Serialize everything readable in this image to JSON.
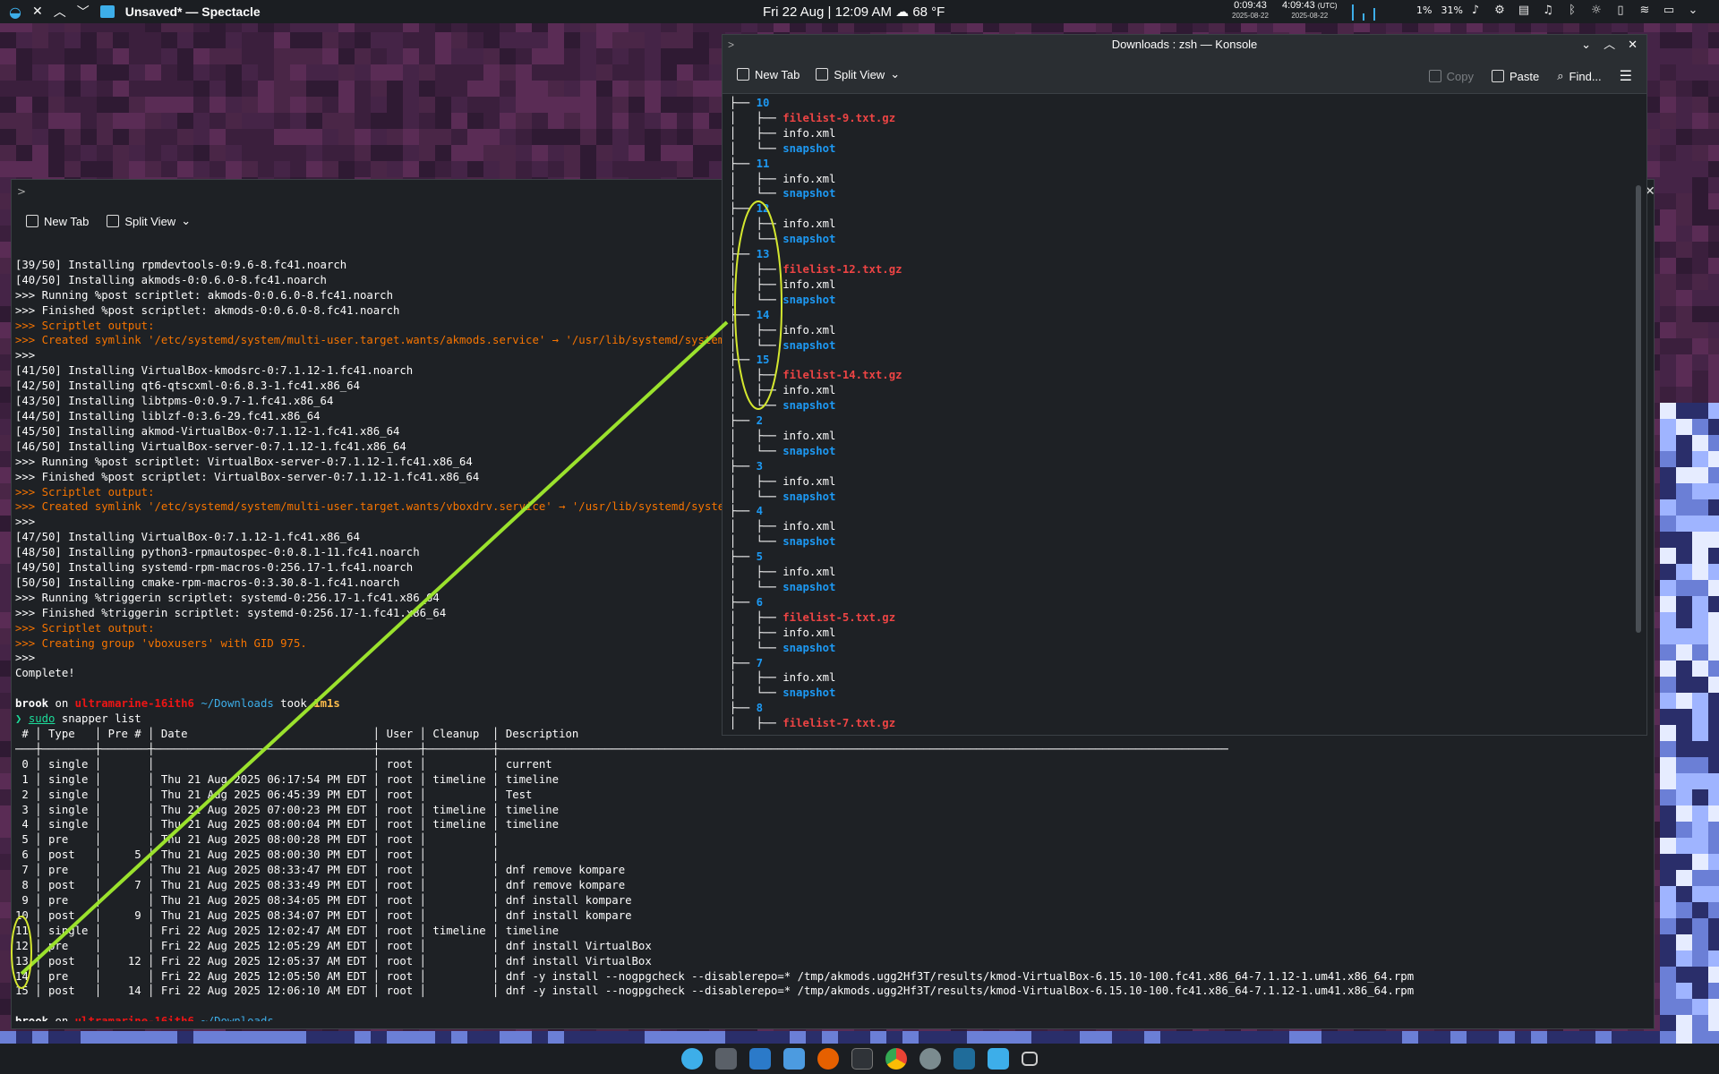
{
  "top_panel": {
    "app_title": "Unsaved* — Spectacle",
    "clock": "Fri 22 Aug | 12:09 AM",
    "weather": "68 °F",
    "tz_local_time": "0:09:43",
    "tz_local_date": "2025-08-22",
    "tz_utc_time": "4:09:43",
    "tz_utc_label": "(UTC)",
    "tz_utc_date": "2025-08-22",
    "cpu": "1%",
    "mem": "31%"
  },
  "back_window": {
    "toolbar": {
      "new_tab": "New Tab",
      "split_view": "Split View"
    },
    "install_lines": [
      "[39/50] Installing rpmdevtools-0:9.6-8.fc41.noarch",
      "[40/50] Installing akmods-0:0.6.0-8.fc41.noarch",
      ">>> Running %post scriptlet: akmods-0:0.6.0-8.fc41.noarch",
      ">>> Finished %post scriptlet: akmods-0:0.6.0-8.fc41.noarch"
    ],
    "scriptlet_1": ">>> Scriptlet output:",
    "symlink_1": ">>> Created symlink '/etc/systemd/system/multi-user.target.wants/akmods.service' → '/usr/lib/systemd/system/akmods.service'.",
    "sep_1": ">>>",
    "install_lines_2": [
      "[41/50] Installing VirtualBox-kmodsrc-0:7.1.12-1.fc41.noarch",
      "[42/50] Installing qt6-qtscxml-0:6.8.3-1.fc41.x86_64",
      "[43/50] Installing libtpms-0:0.9.7-1.fc41.x86_64",
      "[44/50] Installing liblzf-0:3.6-29.fc41.x86_64",
      "[45/50] Installing akmod-VirtualBox-0:7.1.12-1.fc41.x86_64",
      "[46/50] Installing VirtualBox-server-0:7.1.12-1.fc41.x86_64",
      ">>> Running %post scriptlet: VirtualBox-server-0:7.1.12-1.fc41.x86_64",
      ">>> Finished %post scriptlet: VirtualBox-server-0:7.1.12-1.fc41.x86_64"
    ],
    "scriptlet_2": ">>> Scriptlet output:",
    "symlink_2": ">>> Created symlink '/etc/systemd/system/multi-user.target.wants/vboxdrv.service' → '/usr/lib/systemd/system/vboxdrv.service'.",
    "sep_2": ">>>",
    "install_lines_3": [
      "[47/50] Installing VirtualBox-0:7.1.12-1.fc41.x86_64",
      "[48/50] Installing python3-rpmautospec-0:0.8.1-11.fc41.noarch",
      "[49/50] Installing systemd-rpm-macros-0:256.17-1.fc41.noarch",
      "[50/50] Installing cmake-rpm-macros-0:3.30.8-1.fc41.noarch",
      ">>> Running %triggerin scriptlet: systemd-0:256.17-1.fc41.x86_64",
      ">>> Finished %triggerin scriptlet: systemd-0:256.17-1.fc41.x86_64"
    ],
    "scriptlet_3": ">>> Scriptlet output:",
    "group_line": ">>> Creating group 'vboxusers' with GID 975.",
    "sep_3": ">>>",
    "complete": "Complete!",
    "prompt_user": "brook",
    "prompt_on": "on",
    "prompt_host": "ultramarine-16ith6",
    "prompt_dir": "~/Downloads",
    "prompt_took": "took",
    "prompt_time": "1m1s",
    "prompt_char": "❯",
    "cmd_sudo": "sudo",
    "cmd_rest": "snapper list",
    "table_header": " # │ Type   │ Pre # │ Date                            │ User │ Cleanup  │ Description",
    "table_sep": "───┼────────┼───────┼─────────────────────────────────┼──────┼──────────┼──────────────────────────────────────────────────────────────────────────────────────────────────────────────",
    "table_rows": [
      " 0 │ single │       │                                 │ root │          │ current",
      " 1 │ single │       │ Thu 21 Aug 2025 06:17:54 PM EDT │ root │ timeline │ timeline",
      " 2 │ single │       │ Thu 21 Aug 2025 06:45:39 PM EDT │ root │          │ Test",
      " 3 │ single │       │ Thu 21 Aug 2025 07:00:23 PM EDT │ root │ timeline │ timeline",
      " 4 │ single │       │ Thu 21 Aug 2025 08:00:04 PM EDT │ root │ timeline │ timeline",
      " 5 │ pre    │       │ Thu 21 Aug 2025 08:00:28 PM EDT │ root │          │",
      " 6 │ post   │     5 │ Thu 21 Aug 2025 08:00:30 PM EDT │ root │          │",
      " 7 │ pre    │       │ Thu 21 Aug 2025 08:33:47 PM EDT │ root │          │ dnf remove kompare",
      " 8 │ post   │     7 │ Thu 21 Aug 2025 08:33:49 PM EDT │ root │          │ dnf remove kompare",
      " 9 │ pre    │       │ Thu 21 Aug 2025 08:34:05 PM EDT │ root │          │ dnf install kompare",
      "10 │ post   │     9 │ Thu 21 Aug 2025 08:34:07 PM EDT │ root │          │ dnf install kompare",
      "11 │ single │       │ Fri 22 Aug 2025 12:02:47 AM EDT │ root │ timeline │ timeline",
      "12 │ pre    │       │ Fri 22 Aug 2025 12:05:29 AM EDT │ root │          │ dnf install VirtualBox",
      "13 │ post   │    12 │ Fri 22 Aug 2025 12:05:37 AM EDT │ root │          │ dnf install VirtualBox",
      "14 │ pre    │       │ Fri 22 Aug 2025 12:05:50 AM EDT │ root │          │ dnf -y install --nogpgcheck --disablerepo=* /tmp/akmods.ugg2Hf3T/results/kmod-VirtualBox-6.15.10-100.fc41.x86_64-7.1.12-1.um41.x86_64.rpm",
      "15 │ post   │    14 │ Fri 22 Aug 2025 12:06:10 AM EDT │ root │          │ dnf -y install --nogpgcheck --disablerepo=* /tmp/akmods.ugg2Hf3T/results/kmod-VirtualBox-6.15.10-100.fc41.x86_64-7.1.12-1.um41.x86_64.rpm"
    ]
  },
  "front_window": {
    "title": "Downloads : zsh — Konsole",
    "toolbar": {
      "new_tab": "New Tab",
      "split_view": "Split View",
      "copy": "Copy",
      "paste": "Paste",
      "find": "Find..."
    },
    "tree": [
      {
        "indent": "├── ",
        "text": "10",
        "kind": "dir"
      },
      {
        "indent": "│   ├── ",
        "text": "filelist-9.txt.gz",
        "kind": "gz"
      },
      {
        "indent": "│   ├── ",
        "text": "info.xml",
        "kind": "file"
      },
      {
        "indent": "│   └── ",
        "text": "snapshot",
        "kind": "snap"
      },
      {
        "indent": "├── ",
        "text": "11",
        "kind": "dir"
      },
      {
        "indent": "│   ├── ",
        "text": "info.xml",
        "kind": "file"
      },
      {
        "indent": "│   └── ",
        "text": "snapshot",
        "kind": "snap"
      },
      {
        "indent": "├── ",
        "text": "12",
        "kind": "dir"
      },
      {
        "indent": "│   ├── ",
        "text": "info.xml",
        "kind": "file"
      },
      {
        "indent": "│   └── ",
        "text": "snapshot",
        "kind": "snap"
      },
      {
        "indent": "├── ",
        "text": "13",
        "kind": "dir"
      },
      {
        "indent": "│   ├── ",
        "text": "filelist-12.txt.gz",
        "kind": "gz"
      },
      {
        "indent": "│   ├── ",
        "text": "info.xml",
        "kind": "file"
      },
      {
        "indent": "│   └── ",
        "text": "snapshot",
        "kind": "snap"
      },
      {
        "indent": "├── ",
        "text": "14",
        "kind": "dir"
      },
      {
        "indent": "│   ├── ",
        "text": "info.xml",
        "kind": "file"
      },
      {
        "indent": "│   └── ",
        "text": "snapshot",
        "kind": "snap"
      },
      {
        "indent": "├── ",
        "text": "15",
        "kind": "dir"
      },
      {
        "indent": "│   ├── ",
        "text": "filelist-14.txt.gz",
        "kind": "gz"
      },
      {
        "indent": "│   ├── ",
        "text": "info.xml",
        "kind": "file"
      },
      {
        "indent": "│   └── ",
        "text": "snapshot",
        "kind": "snap"
      },
      {
        "indent": "├── ",
        "text": "2",
        "kind": "dir"
      },
      {
        "indent": "│   ├── ",
        "text": "info.xml",
        "kind": "file"
      },
      {
        "indent": "│   └── ",
        "text": "snapshot",
        "kind": "snap"
      },
      {
        "indent": "├── ",
        "text": "3",
        "kind": "dir"
      },
      {
        "indent": "│   ├── ",
        "text": "info.xml",
        "kind": "file"
      },
      {
        "indent": "│   └── ",
        "text": "snapshot",
        "kind": "snap"
      },
      {
        "indent": "├── ",
        "text": "4",
        "kind": "dir"
      },
      {
        "indent": "│   ├── ",
        "text": "info.xml",
        "kind": "file"
      },
      {
        "indent": "│   └── ",
        "text": "snapshot",
        "kind": "snap"
      },
      {
        "indent": "├── ",
        "text": "5",
        "kind": "dir"
      },
      {
        "indent": "│   ├── ",
        "text": "info.xml",
        "kind": "file"
      },
      {
        "indent": "│   └── ",
        "text": "snapshot",
        "kind": "snap"
      },
      {
        "indent": "├── ",
        "text": "6",
        "kind": "dir"
      },
      {
        "indent": "│   ├── ",
        "text": "filelist-5.txt.gz",
        "kind": "gz"
      },
      {
        "indent": "│   ├── ",
        "text": "info.xml",
        "kind": "file"
      },
      {
        "indent": "│   └── ",
        "text": "snapshot",
        "kind": "snap"
      },
      {
        "indent": "├── ",
        "text": "7",
        "kind": "dir"
      },
      {
        "indent": "│   ├── ",
        "text": "info.xml",
        "kind": "file"
      },
      {
        "indent": "│   └── ",
        "text": "snapshot",
        "kind": "snap"
      },
      {
        "indent": "├── ",
        "text": "8",
        "kind": "dir"
      },
      {
        "indent": "│   ├── ",
        "text": "filelist-7.txt.gz",
        "kind": "gz"
      }
    ]
  },
  "colors": {
    "accent_annotation": "#9be22d",
    "dir_blue": "#1d99f3",
    "gz_red": "#ed4444",
    "orange": "#f67400"
  }
}
